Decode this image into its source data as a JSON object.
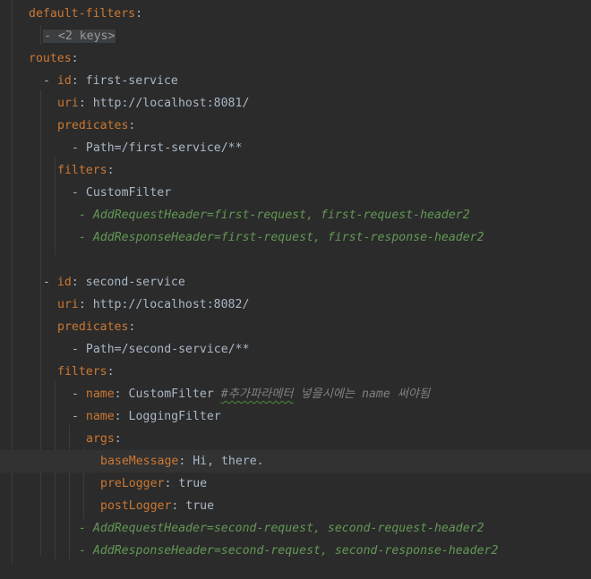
{
  "editor": {
    "lines": [
      {
        "indent": 32,
        "parts": [
          {
            "t": "default-filters",
            "c": "k"
          },
          {
            "t": ":",
            "c": "p"
          }
        ]
      },
      {
        "indent": 48,
        "folded": true,
        "parts": [
          {
            "t": "- <2 keys>",
            "c": "f"
          }
        ]
      },
      {
        "indent": 32,
        "parts": [
          {
            "t": "routes",
            "c": "k"
          },
          {
            "t": ":",
            "c": "p"
          }
        ]
      },
      {
        "indent": 48,
        "parts": [
          {
            "t": "- ",
            "c": "p"
          },
          {
            "t": "id",
            "c": "k"
          },
          {
            "t": ": first-service",
            "c": "v"
          }
        ]
      },
      {
        "indent": 64,
        "parts": [
          {
            "t": "uri",
            "c": "k"
          },
          {
            "t": ": http://localhost:8081/",
            "c": "v"
          }
        ]
      },
      {
        "indent": 64,
        "parts": [
          {
            "t": "predicates",
            "c": "k"
          },
          {
            "t": ":",
            "c": "p"
          }
        ]
      },
      {
        "indent": 80,
        "parts": [
          {
            "t": "- Path=/first-service/**",
            "c": "v"
          }
        ]
      },
      {
        "indent": 64,
        "parts": [
          {
            "t": "filters",
            "c": "k"
          },
          {
            "t": ":",
            "c": "p"
          }
        ]
      },
      {
        "indent": 80,
        "parts": [
          {
            "t": "- CustomFilter",
            "c": "v"
          }
        ]
      },
      {
        "indent": 88,
        "parts": [
          {
            "t": "- AddRequestHeader=first-request, first-request-header2",
            "c": "c"
          }
        ]
      },
      {
        "indent": 88,
        "parts": [
          {
            "t": "- AddResponseHeader=first-request, first-response-header2",
            "c": "c"
          }
        ]
      },
      {
        "indent": 0,
        "parts": []
      },
      {
        "indent": 48,
        "parts": [
          {
            "t": "- ",
            "c": "p"
          },
          {
            "t": "id",
            "c": "k"
          },
          {
            "t": ": second-service",
            "c": "v"
          }
        ]
      },
      {
        "indent": 64,
        "parts": [
          {
            "t": "uri",
            "c": "k"
          },
          {
            "t": ": http://localhost:8082/",
            "c": "v"
          }
        ]
      },
      {
        "indent": 64,
        "parts": [
          {
            "t": "predicates",
            "c": "k"
          },
          {
            "t": ":",
            "c": "p"
          }
        ]
      },
      {
        "indent": 80,
        "parts": [
          {
            "t": "- Path=/second-service/**",
            "c": "v"
          }
        ]
      },
      {
        "indent": 64,
        "parts": [
          {
            "t": "filters",
            "c": "k"
          },
          {
            "t": ":",
            "c": "p"
          }
        ]
      },
      {
        "indent": 80,
        "parts": [
          {
            "t": "- ",
            "c": "p"
          },
          {
            "t": "name",
            "c": "k"
          },
          {
            "t": ": CustomFilter ",
            "c": "v"
          },
          {
            "t": "#추가파라메터",
            "c": "cm",
            "typo": true
          },
          {
            "t": " 넣을시에는 name 써야됨",
            "c": "cm"
          }
        ]
      },
      {
        "indent": 80,
        "parts": [
          {
            "t": "- ",
            "c": "p"
          },
          {
            "t": "name",
            "c": "k"
          },
          {
            "t": ": LoggingFilter",
            "c": "v"
          }
        ]
      },
      {
        "indent": 96,
        "parts": [
          {
            "t": "args",
            "c": "k"
          },
          {
            "t": ":",
            "c": "p"
          }
        ]
      },
      {
        "indent": 112,
        "current": true,
        "parts": [
          {
            "t": "baseMessage",
            "c": "k"
          },
          {
            "t": ": Hi, there.",
            "c": "v"
          }
        ]
      },
      {
        "indent": 112,
        "parts": [
          {
            "t": "preLogger",
            "c": "k"
          },
          {
            "t": ": true",
            "c": "v"
          }
        ]
      },
      {
        "indent": 112,
        "parts": [
          {
            "t": "postLogger",
            "c": "k"
          },
          {
            "t": ": true",
            "c": "v"
          }
        ]
      },
      {
        "indent": 88,
        "parts": [
          {
            "t": "- AddRequestHeader=second-request, second-request-header2",
            "c": "c"
          }
        ]
      },
      {
        "indent": 88,
        "parts": [
          {
            "t": "- AddResponseHeader=second-request, second-response-header2",
            "c": "c"
          }
        ]
      }
    ]
  },
  "colors": {
    "background": "#2b2b2b",
    "key": "#cc7832",
    "value": "#a9b7c6",
    "disabled_filter": "#629755",
    "comment": "#808080",
    "current_line": "#323232"
  }
}
